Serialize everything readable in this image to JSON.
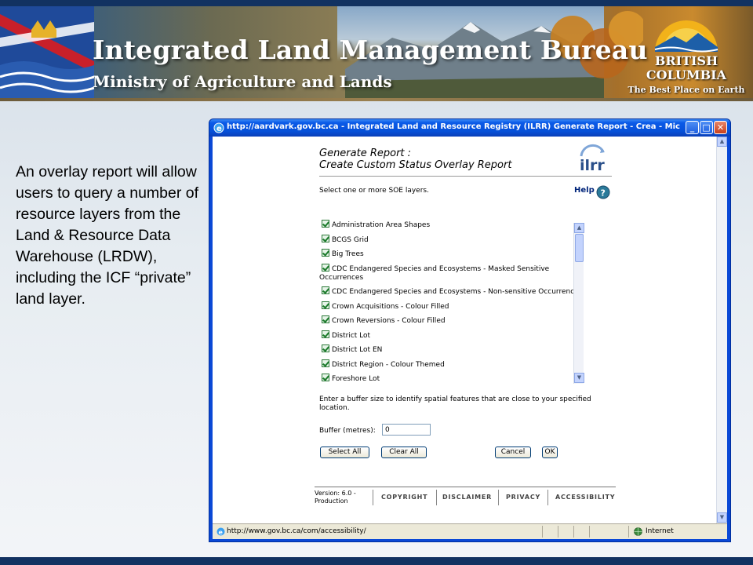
{
  "banner": {
    "title": "Integrated Land Management Bureau",
    "subtitle": "Ministry of Agriculture and Lands",
    "logo_line1": "BRITISH",
    "logo_line2": "COLUMBIA",
    "logo_tagline": "The Best Place on Earth"
  },
  "description": "An overlay report will allow users to query a number of resource layers from the Land & Resource Data Warehouse (LRDW), including the ICF “private” land layer.",
  "browser": {
    "title": "http://aardvark.gov.bc.ca - Integrated Land and Resource Registry (ILRR) Generate Report - Crea - Microsoft Int...",
    "status_url": "http://www.gov.bc.ca/com/accessibility/",
    "zone": "Internet"
  },
  "page": {
    "title_line1": "Generate Report :",
    "title_line2": "Create Custom Status Overlay Report",
    "logo_text": "ilrr",
    "instruction": "Select one or more SOE layers.",
    "help_label": "Help",
    "layers": [
      {
        "label": "Administration Area Shapes",
        "checked": true
      },
      {
        "label": "BCGS Grid",
        "checked": true
      },
      {
        "label": "Big Trees",
        "checked": true
      },
      {
        "label": "CDC Endangered Species and Ecosystems - Masked Sensitive Occurrences",
        "checked": true
      },
      {
        "label": "CDC Endangered Species and Ecosystems - Non-sensitive Occurrences",
        "checked": true
      },
      {
        "label": "Crown Acquisitions - Colour Filled",
        "checked": true
      },
      {
        "label": "Crown Reversions - Colour Filled",
        "checked": true
      },
      {
        "label": "District Lot",
        "checked": true
      },
      {
        "label": "District Lot EN",
        "checked": true
      },
      {
        "label": "District Region - Colour Themed",
        "checked": true
      },
      {
        "label": "Foreshore Lot",
        "checked": true
      }
    ],
    "buffer_instruction": "Enter a buffer size to identify spatial features that are close to your specified location.",
    "buffer_label": "Buffer (metres):",
    "buffer_value": "0",
    "buttons": {
      "select_all": "Select All",
      "clear_all": "Clear All",
      "cancel": "Cancel",
      "ok": "OK"
    },
    "footer": {
      "version": "Version: 6.0 - Production",
      "links": [
        "COPYRIGHT",
        "DISCLAIMER",
        "PRIVACY",
        "ACCESSIBILITY"
      ]
    }
  },
  "colors": {
    "navy": "#123261",
    "xp_title_blue": "#0650d8",
    "help_blue": "#00247a",
    "check_green": "#1a7a2a"
  }
}
